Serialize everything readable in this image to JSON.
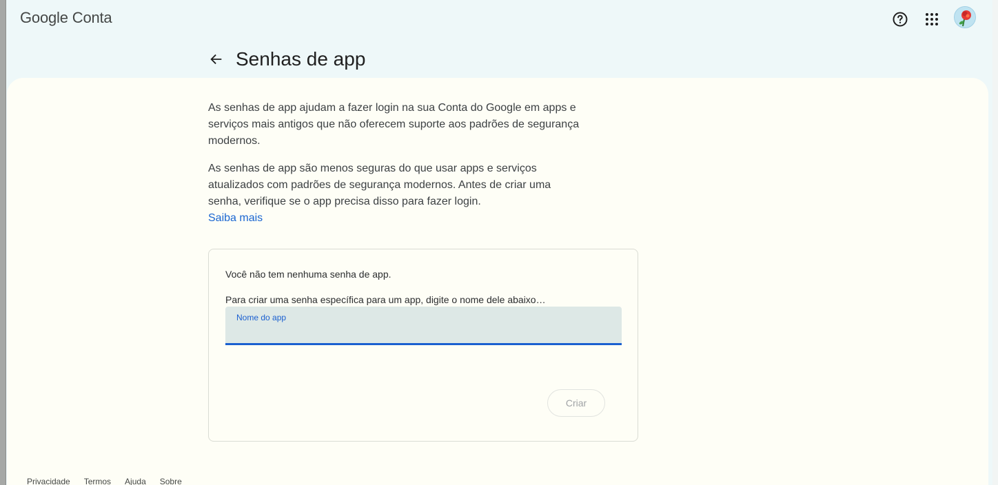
{
  "header": {
    "brand_google": "Google",
    "brand_product": "Conta",
    "help_icon": "help-circle-icon",
    "apps_icon": "apps-grid-icon",
    "avatar_icon": "rose-avatar-icon"
  },
  "page": {
    "title": "Senhas de app",
    "back_icon": "arrow-left-icon"
  },
  "intro": {
    "paragraph1": "As senhas de app ajudam a fazer login na sua Conta do Google em apps e serviços mais antigos que não oferecem suporte aos padrões de segurança modernos.",
    "paragraph2": "As senhas de app são menos seguras do que usar apps e serviços atualizados com padrões de segurança modernos. Antes de criar uma senha, verifique se o app precisa disso para fazer login.",
    "learn_more": "Saiba mais"
  },
  "card": {
    "empty_message": "Você não tem nenhuma senha de app.",
    "instruction": "Para criar uma senha específica para um app, digite o nome dele abaixo…",
    "field_label": "Nome do app",
    "field_value": "",
    "create_label": "Criar"
  },
  "footer": {
    "privacy": "Privacidade",
    "terms": "Termos",
    "help": "Ajuda",
    "about": "Sobre"
  },
  "colors": {
    "link": "#1a66d1",
    "focus": "#1a5fd0",
    "field_bg": "#dde8e6",
    "header_bg": "#eef8f9",
    "sheet_bg": "#fefef6"
  }
}
